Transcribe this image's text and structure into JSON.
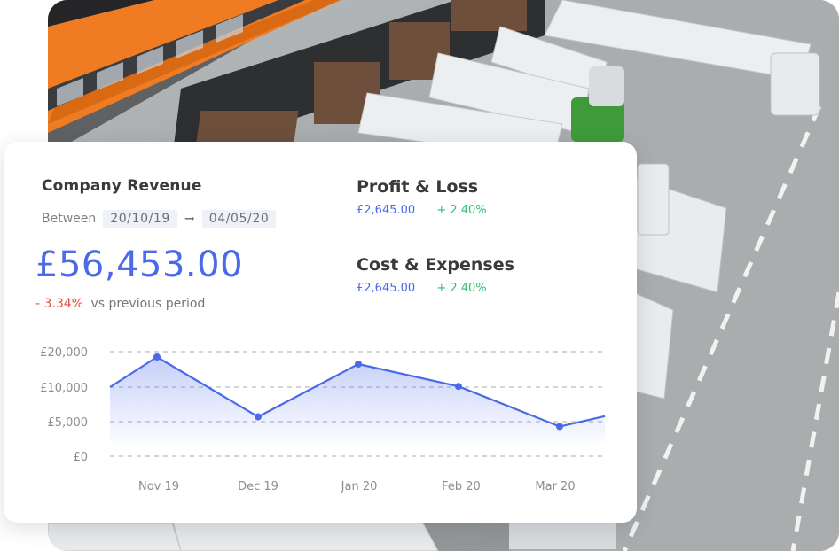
{
  "revenue": {
    "title": "Company Revenue",
    "range_label": "Between",
    "start_date": "20/10/19",
    "end_date": "04/05/20",
    "total": "£56,453.00",
    "change": "- 3.34%",
    "change_text": "vs previous period"
  },
  "metrics": [
    {
      "title": "Profit & Loss",
      "amount": "£2,645.00",
      "change": "+ 2.40%"
    },
    {
      "title": "Cost & Expenses",
      "amount": "£2,645.00",
      "change": "+ 2.40%"
    }
  ],
  "colors": {
    "accent": "#4a6ae8",
    "negative": "#e74c3c",
    "positive": "#2fbf71"
  },
  "chart_data": {
    "type": "area",
    "title": "",
    "xlabel": "",
    "ylabel": "",
    "y_tick_labels": [
      "£20,000",
      "£10,000",
      "£5,000",
      "£0"
    ],
    "x_tick_labels": [
      "Nov 19",
      "Dec 19",
      "Jan 20",
      "Feb 20",
      "Mar 20"
    ],
    "x": [
      "start",
      "Nov 19",
      "Dec 19",
      "Jan 20",
      "Feb 20",
      "Mar 20",
      "end"
    ],
    "values": [
      10000,
      18500,
      5700,
      16500,
      10200,
      4300,
      5800
    ],
    "grid": true,
    "legend": "none"
  }
}
